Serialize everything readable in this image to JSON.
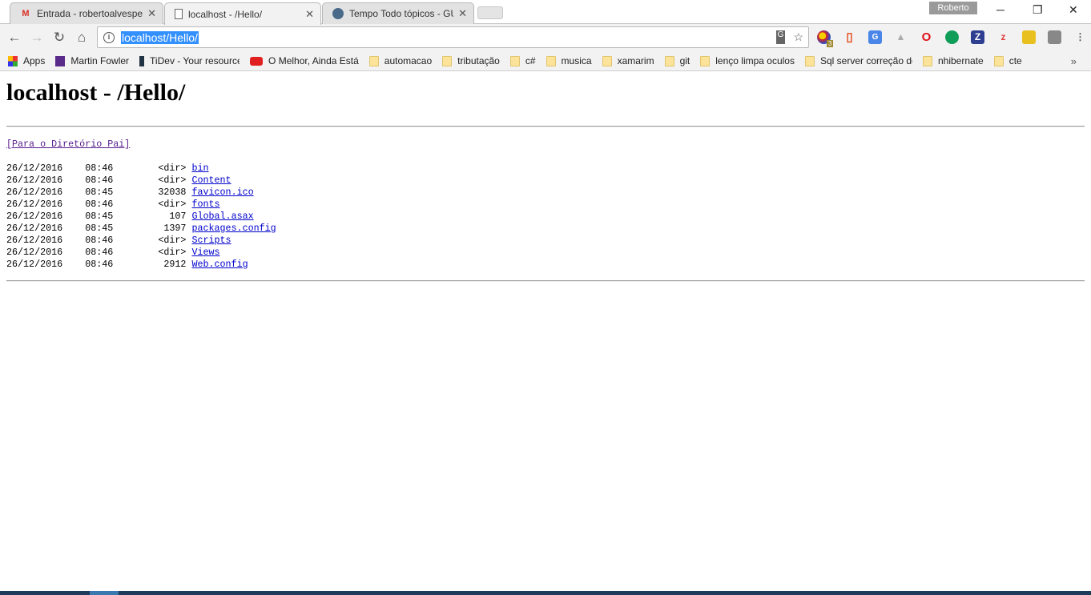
{
  "tabs": [
    {
      "label": "Entrada - robertoalvesper",
      "icon": "gmail-icon",
      "active": false
    },
    {
      "label": "localhost - /Hello/",
      "icon": "page-icon",
      "active": true
    },
    {
      "label": "Tempo Todo tópicos - GU",
      "icon": "globe-icon",
      "active": false
    }
  ],
  "profile": "Roberto",
  "address": {
    "url": "localhost/Hello/"
  },
  "bookmarks": [
    {
      "label": "Apps",
      "icon": "apps-icon"
    },
    {
      "label": "Martin Fowler",
      "icon": "fowler-icon"
    },
    {
      "label": "TiDev - Your resource",
      "icon": "tidev-icon"
    },
    {
      "label": "O Melhor, Ainda Está",
      "icon": "youtube-icon"
    },
    {
      "label": "automacao",
      "icon": "folder-icon"
    },
    {
      "label": "tributação",
      "icon": "folder-icon"
    },
    {
      "label": "c#",
      "icon": "folder-icon"
    },
    {
      "label": "musica",
      "icon": "folder-icon"
    },
    {
      "label": "xamarim",
      "icon": "folder-icon"
    },
    {
      "label": "git",
      "icon": "folder-icon"
    },
    {
      "label": "lenço limpa oculos",
      "icon": "folder-icon"
    },
    {
      "label": "Sql server correção de",
      "icon": "folder-icon"
    },
    {
      "label": "nhibernate",
      "icon": "folder-icon"
    },
    {
      "label": "cte",
      "icon": "folder-icon"
    }
  ],
  "extension_badge": "3",
  "page": {
    "title": "localhost - /Hello/",
    "parent_link": "[Para o Diretório Pai]",
    "entries": [
      {
        "date": "26/12/2016",
        "time": "08:46",
        "size": "<dir>",
        "name": "bin"
      },
      {
        "date": "26/12/2016",
        "time": "08:46",
        "size": "<dir>",
        "name": "Content"
      },
      {
        "date": "26/12/2016",
        "time": "08:45",
        "size": "32038",
        "name": "favicon.ico"
      },
      {
        "date": "26/12/2016",
        "time": "08:46",
        "size": "<dir>",
        "name": "fonts"
      },
      {
        "date": "26/12/2016",
        "time": "08:45",
        "size": "107",
        "name": "Global.asax"
      },
      {
        "date": "26/12/2016",
        "time": "08:45",
        "size": "1397",
        "name": "packages.config"
      },
      {
        "date": "26/12/2016",
        "time": "08:46",
        "size": "<dir>",
        "name": "Scripts"
      },
      {
        "date": "26/12/2016",
        "time": "08:46",
        "size": "<dir>",
        "name": "Views"
      },
      {
        "date": "26/12/2016",
        "time": "08:46",
        "size": "2912",
        "name": "Web.config"
      }
    ]
  }
}
